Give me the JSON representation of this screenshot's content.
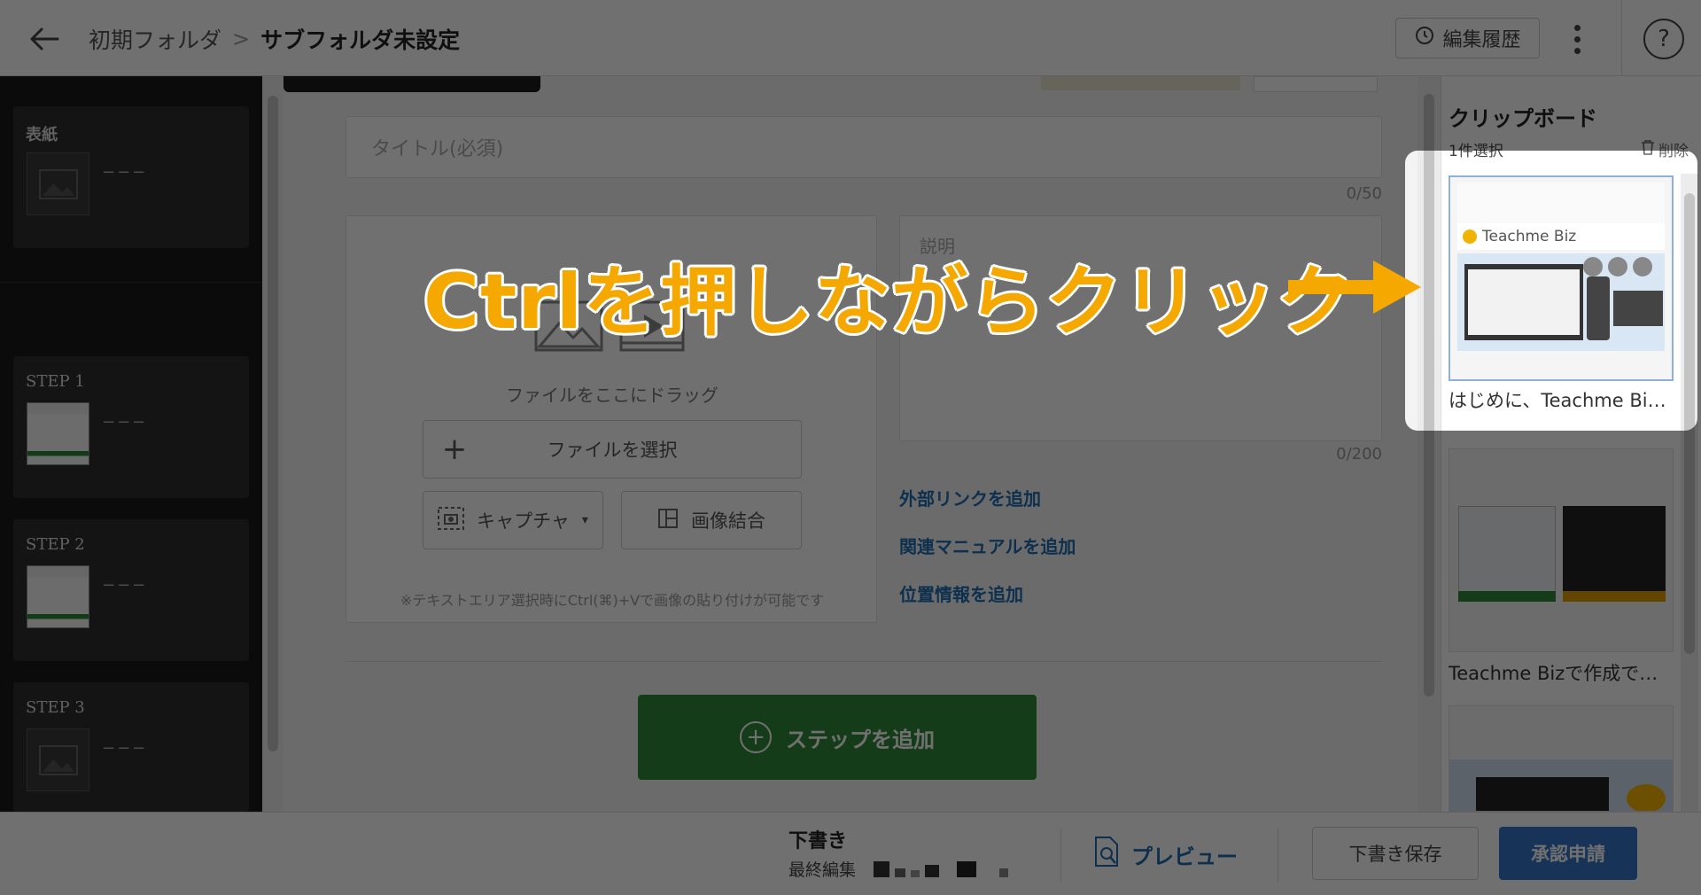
{
  "header": {
    "breadcrumb_root": "初期フォルダ",
    "breadcrumb_separator": ">",
    "breadcrumb_current": "サブフォルダ未設定",
    "history_label": "編集履歴",
    "help_label": "?"
  },
  "sidebar": {
    "cover_label": "表紙",
    "placeholder_dash": "−−−",
    "steps": [
      {
        "label": "STEP 1"
      },
      {
        "label": "STEP 2"
      },
      {
        "label": "STEP 3"
      }
    ]
  },
  "editor": {
    "title_placeholder": "タイトル(必須)",
    "title_count": "0/50",
    "drag_text": "ファイルをここにドラッグ",
    "file_select_label": "ファイルを選択",
    "capture_label": "キャプチャ",
    "merge_label": "画像結合",
    "paste_note": "※テキストエリア選択時にCtrl(⌘)+Vで画像の貼り付けが可能です",
    "description_placeholder": "説明",
    "description_count": "0/200",
    "add_external_link": "外部リンクを追加",
    "add_related_manual": "関連マニュアルを追加",
    "add_location": "位置情報を追加",
    "add_step_label": "ステップを追加"
  },
  "clipboard": {
    "title": "クリップボード",
    "selected_count": "1件選択",
    "delete_label": "削除",
    "items": [
      {
        "caption": "はじめに、Teachme Biz…",
        "selected": true
      },
      {
        "caption": "Teachme Bizで作成で…",
        "selected": false
      },
      {
        "caption": "",
        "selected": false
      }
    ],
    "thumb_brand": "Teachme Biz"
  },
  "footer": {
    "status": "下書き",
    "last_edited_label": "最終編集",
    "preview_label": "プレビュー",
    "save_draft_label": "下書き保存",
    "approve_label": "承認申請"
  },
  "annotation": {
    "text": "Ctrlを押しながらクリック",
    "color": "#f5a800"
  },
  "colors": {
    "accent_blue": "#1f6fb2",
    "approve_blue": "#3578c8",
    "add_step_green": "#2f8a3a",
    "sidebar_dark": "#1b1b1b"
  }
}
